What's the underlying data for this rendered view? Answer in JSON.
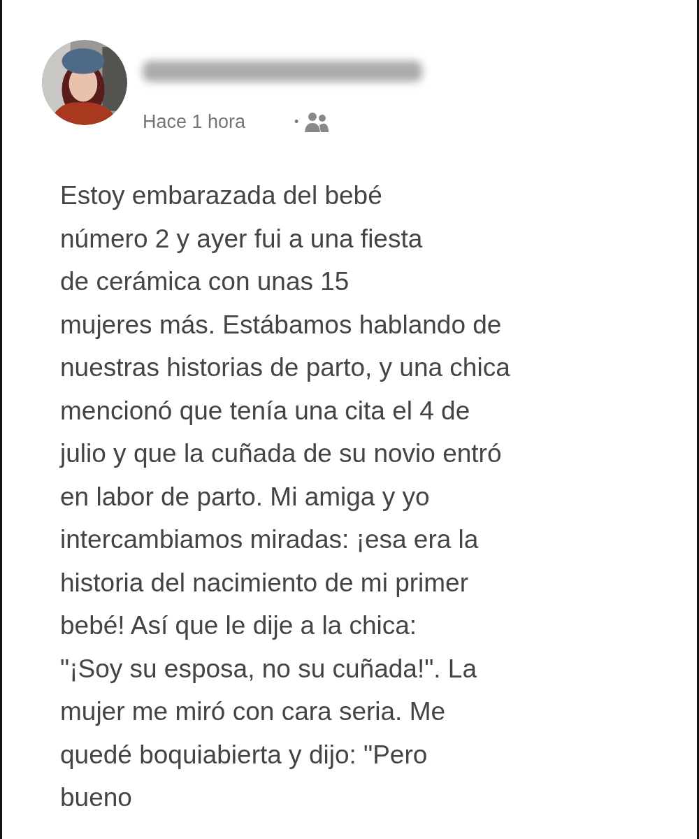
{
  "post": {
    "time": "Hace 1 hora",
    "separator": "•",
    "body_lines": [
      "Estoy embarazada del bebé",
      "número 2 y ayer fui a una fiesta",
      "de cerámica con unas 15",
      "mujeres más. Estábamos hablando de",
      "nuestras historias de parto, y una chica",
      "mencionó que tenía una cita el 4 de",
      "julio y que la cuñada de su novio entró",
      "en labor de parto. Mi amiga y yo",
      "intercambiamos miradas: ¡esa era la",
      "historia del nacimiento de mi primer",
      "bebé! Así que le dije a la chica:",
      "\"¡Soy su esposa, no su cuñada!\". La",
      "mujer me miró con cara seria. Me",
      "quedé boquiabierta y dijo: \"Pero",
      "bueno"
    ]
  }
}
